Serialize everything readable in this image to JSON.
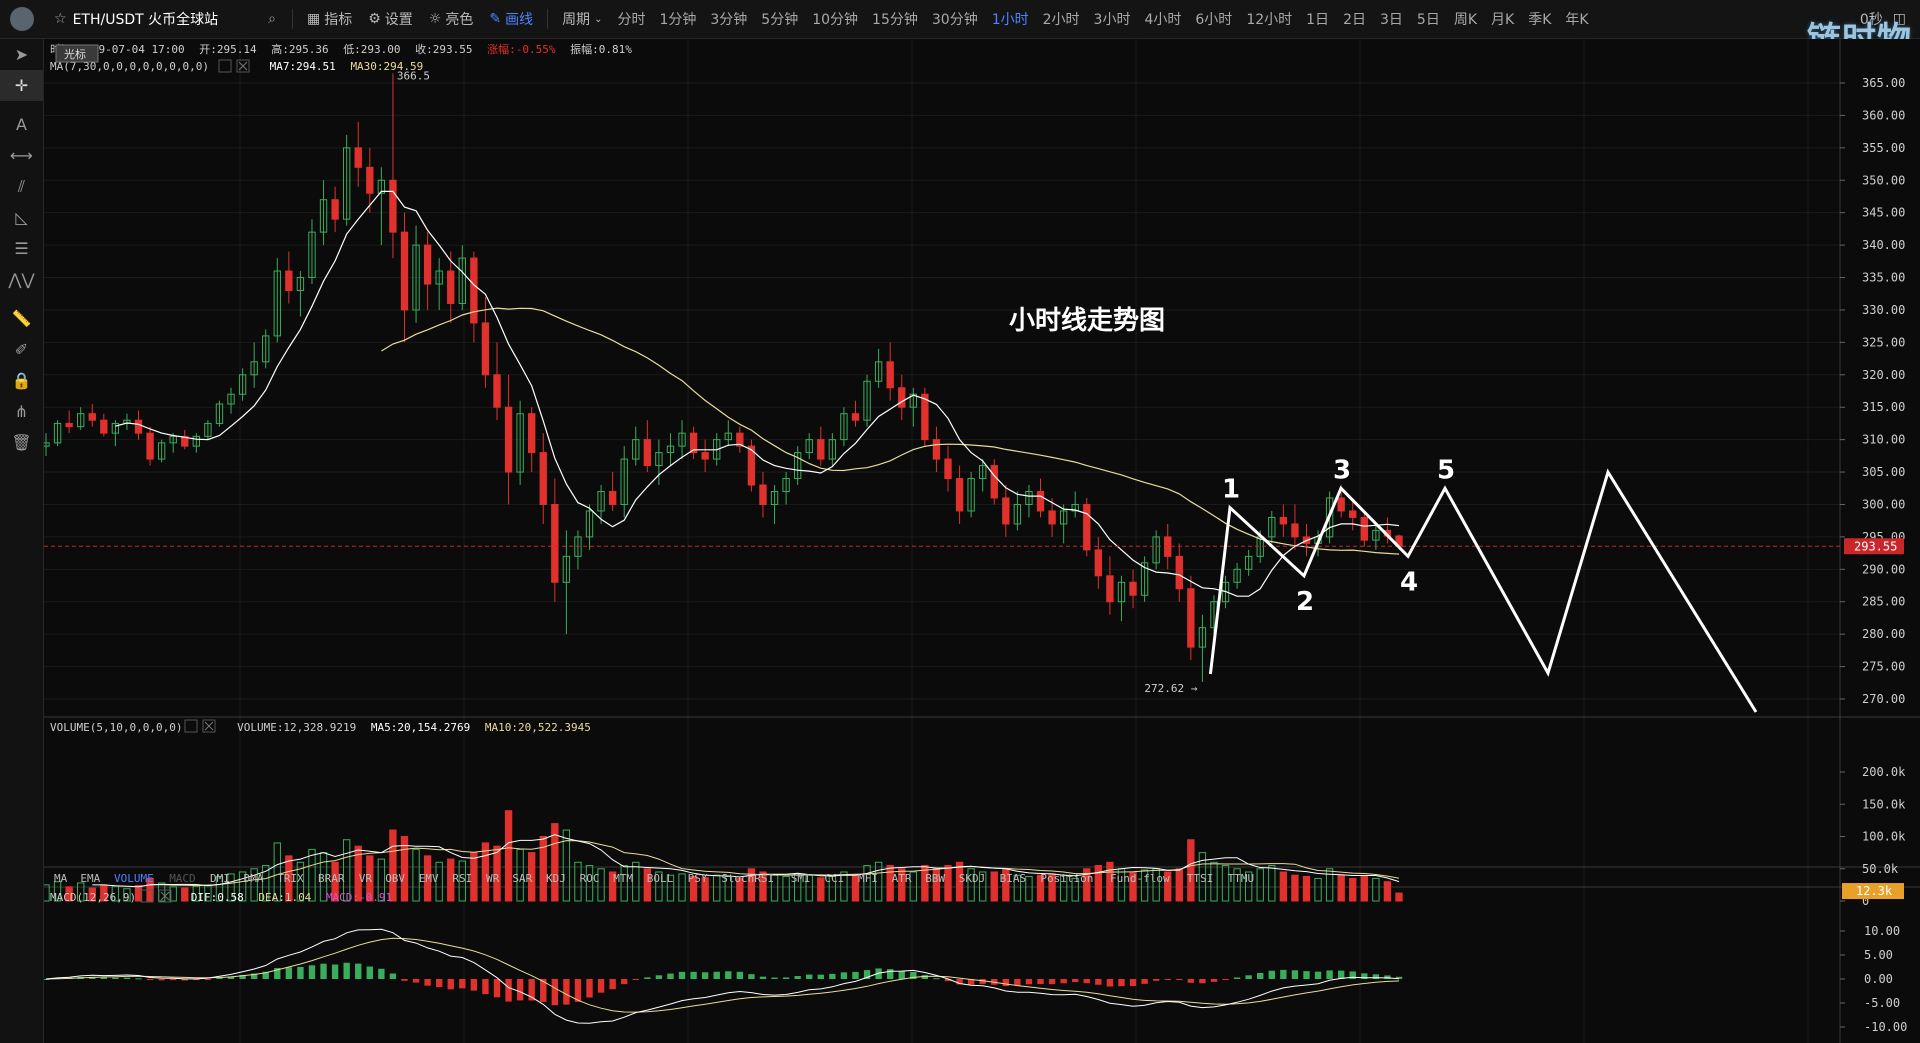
{
  "toolbar": {
    "pair": "ETH/USDT 火币全球站",
    "indicators_label": "指标",
    "settings_label": "设置",
    "theme_label": "亮色",
    "draw_label": "画线",
    "period_label": "周期",
    "periods": [
      "分时",
      "1分钟",
      "3分钟",
      "5分钟",
      "10分钟",
      "15分钟",
      "30分钟",
      "1小时",
      "2小时",
      "3小时",
      "4小时",
      "6小时",
      "12小时",
      "1日",
      "2日",
      "3日",
      "5日",
      "周K",
      "月K",
      "季K",
      "年K"
    ],
    "active_period": "1小时",
    "countdown": "0秒"
  },
  "brand": "链时物",
  "info_line": {
    "time": "时间:2019-07-04 17:00",
    "open": "开:295.14",
    "high": "高:295.36",
    "low": "低:293.00",
    "close": "收:293.55",
    "change": "涨幅:-0.55%",
    "amplitude": "振幅:0.81%"
  },
  "ma_line": {
    "label": "MA(7,30,0,0,0,0,0,0,0,0)",
    "ma7": "MA7:294.51",
    "ma30": "MA30:294.59"
  },
  "cursor_tag": "光标",
  "volume_line": {
    "label": "VOLUME(5,10,0,0,0,0)",
    "volume": "VOLUME:12,328.9219",
    "ma5": "MA5:20,154.2769",
    "ma10": "MA10:20,522.3945"
  },
  "indicator_tabs": [
    "MA",
    "EMA",
    "VOLUME",
    "MACD",
    "DMI",
    "DMA",
    "TRIX",
    "BRAR",
    "VR",
    "OBV",
    "EMV",
    "RSI",
    "WR",
    "SAR",
    "KDJ",
    "ROC",
    "MTM",
    "BOLL",
    "PSY",
    "StochRSI",
    "SMI",
    "CCI",
    "MFI",
    "ATR",
    "BBW",
    "SKDJ",
    "BIAS",
    "Position",
    "Fund-flow",
    "TTSI",
    "TTMU"
  ],
  "active_indicator_tab": "VOLUME",
  "macd_line": {
    "label": "MACD(12,26,9)",
    "dif": "DIF:0.58",
    "dea": "DEA:1.04",
    "macd": "MACD:-0.91"
  },
  "annotation_title": "小时线走势图",
  "wave_labels": [
    "1",
    "2",
    "3",
    "4",
    "5"
  ],
  "colors": {
    "up": "#3aad5c",
    "down": "#e0312d",
    "ma7": "#ffffff",
    "ma30": "#e8dc9a",
    "accent": "#4d82ff",
    "last_price_bg": "#c9262a",
    "volume_tag_bg": "#e8a02a"
  },
  "icons": [
    "cursor-icon",
    "crosshair-icon",
    "text-icon",
    "line-icon",
    "channel-icon",
    "triangle-icon",
    "fibonacci-icon",
    "pattern-icon",
    "ruler-icon",
    "brush-icon",
    "lock-icon",
    "magnet-icon",
    "trash-icon"
  ],
  "chart_data": {
    "type": "candlestick",
    "symbol": "ETH/USDT",
    "interval": "1小时",
    "price_axis": {
      "ticks": [
        270,
        275,
        280,
        285,
        290,
        295,
        300,
        305,
        310,
        315,
        320,
        325,
        330,
        335,
        340,
        345,
        350,
        355,
        360,
        365
      ],
      "range": [
        268,
        368
      ]
    },
    "last_price": 293.55,
    "last_price_label": "293.55",
    "high_marker": {
      "value": 366.5,
      "label": "366.5"
    },
    "low_marker": {
      "value": 272.62,
      "label": "272.62 →"
    },
    "volume_axis": {
      "ticks": [
        0,
        50000,
        100000,
        150000,
        200000
      ],
      "tick_labels": [
        "0",
        "50.0k",
        "100.0k",
        "150.0k",
        "200.0k"
      ],
      "current_label": "12.3k"
    },
    "macd_axis": {
      "ticks": [
        -10,
        -5,
        0,
        5,
        10
      ],
      "tick_labels": [
        "-10.00",
        "-5.00",
        "0.00",
        "5.00",
        "10.00"
      ]
    },
    "candles_ohlcv": [
      [
        309,
        311,
        307.5,
        309.5,
        25000
      ],
      [
        309.5,
        313,
        309,
        312.5,
        30000
      ],
      [
        312.5,
        314.5,
        311,
        312,
        22000
      ],
      [
        312,
        315,
        311.5,
        314,
        28000
      ],
      [
        314,
        315.5,
        312,
        313,
        20000
      ],
      [
        313,
        314,
        310.5,
        311,
        25000
      ],
      [
        311,
        313,
        309,
        312.5,
        23000
      ],
      [
        312.5,
        314,
        311.5,
        313,
        19000
      ],
      [
        313,
        314.5,
        310,
        311,
        24000
      ],
      [
        311,
        312,
        306,
        307,
        35000
      ],
      [
        307,
        310,
        306.5,
        309.5,
        28000
      ],
      [
        309.5,
        311,
        308,
        310.5,
        22000
      ],
      [
        310.5,
        311.5,
        308.5,
        309,
        20000
      ],
      [
        309,
        311,
        308,
        310.5,
        23000
      ],
      [
        310.5,
        313,
        310,
        312.5,
        25000
      ],
      [
        312.5,
        316,
        312,
        315.5,
        38000
      ],
      [
        315.5,
        318,
        314,
        317,
        42000
      ],
      [
        317,
        321,
        316,
        320,
        45000
      ],
      [
        320,
        325,
        318,
        322,
        50000
      ],
      [
        322,
        327,
        321,
        326,
        55000
      ],
      [
        326,
        338,
        325,
        336,
        90000
      ],
      [
        336,
        339,
        331,
        333,
        70000
      ],
      [
        333,
        336,
        329,
        335,
        60000
      ],
      [
        335,
        344,
        334,
        342,
        80000
      ],
      [
        342,
        350,
        340,
        347,
        75000
      ],
      [
        347,
        349,
        342,
        344,
        60000
      ],
      [
        344,
        357,
        343,
        355,
        95000
      ],
      [
        355,
        359,
        349,
        352,
        85000
      ],
      [
        352,
        355,
        345,
        348,
        70000
      ],
      [
        348,
        352,
        340,
        350,
        65000
      ],
      [
        350,
        366.5,
        338,
        342,
        110000
      ],
      [
        342,
        345,
        325,
        330,
        100000
      ],
      [
        330,
        343,
        328,
        340,
        80000
      ],
      [
        340,
        342,
        330,
        334,
        70000
      ],
      [
        334,
        338,
        330,
        336,
        60000
      ],
      [
        336,
        339,
        328,
        331,
        65000
      ],
      [
        331,
        340,
        330,
        338,
        62000
      ],
      [
        338,
        339,
        325,
        328,
        75000
      ],
      [
        328,
        332,
        318,
        320,
        90000
      ],
      [
        320,
        325,
        313,
        315,
        85000
      ],
      [
        315,
        320,
        300,
        305,
        140000
      ],
      [
        305,
        316,
        303,
        314,
        80000
      ],
      [
        314,
        315,
        305,
        308,
        75000
      ],
      [
        308,
        311,
        297,
        300,
        100000
      ],
      [
        300,
        304,
        285,
        288,
        120000
      ],
      [
        288,
        296,
        280,
        292,
        110000
      ],
      [
        292,
        296,
        290,
        295,
        60000
      ],
      [
        295,
        300,
        293,
        299,
        55000
      ],
      [
        299,
        303,
        297,
        302,
        50000
      ],
      [
        302,
        305,
        299,
        300,
        45000
      ],
      [
        300,
        309,
        298,
        307,
        55000
      ],
      [
        307,
        312,
        306,
        310,
        60000
      ],
      [
        310,
        313,
        305,
        306,
        50000
      ],
      [
        306,
        310,
        303,
        308,
        45000
      ],
      [
        308,
        311,
        306,
        309,
        40000
      ],
      [
        309,
        313,
        307,
        311,
        42000
      ],
      [
        311,
        312,
        307,
        308,
        38000
      ],
      [
        308,
        310,
        305,
        307,
        36000
      ],
      [
        307,
        311,
        306,
        310,
        40000
      ],
      [
        310,
        313,
        309,
        311,
        38000
      ],
      [
        311,
        312,
        308,
        309,
        35000
      ],
      [
        309,
        310,
        302,
        303,
        50000
      ],
      [
        303,
        305,
        298,
        300,
        45000
      ],
      [
        300,
        303,
        297,
        302,
        40000
      ],
      [
        302,
        305,
        300,
        304,
        38000
      ],
      [
        304,
        309,
        303,
        308,
        42000
      ],
      [
        308,
        311,
        307,
        310,
        40000
      ],
      [
        310,
        312,
        306,
        307,
        36000
      ],
      [
        307,
        311,
        306,
        310,
        38000
      ],
      [
        310,
        315,
        309,
        314,
        45000
      ],
      [
        314,
        316,
        312,
        313,
        40000
      ],
      [
        313,
        320,
        312,
        319,
        55000
      ],
      [
        319,
        324,
        318,
        322,
        60000
      ],
      [
        322,
        325,
        316,
        318,
        55000
      ],
      [
        318,
        320,
        313,
        315,
        50000
      ],
      [
        315,
        318,
        312,
        317,
        45000
      ],
      [
        317,
        318,
        309,
        310,
        55000
      ],
      [
        310,
        312,
        305,
        307,
        50000
      ],
      [
        307,
        309,
        302,
        304,
        55000
      ],
      [
        304,
        306,
        297,
        299,
        60000
      ],
      [
        299,
        305,
        298,
        304,
        50000
      ],
      [
        304,
        307,
        302,
        306,
        45000
      ],
      [
        306,
        307,
        300,
        301,
        45000
      ],
      [
        301,
        303,
        295,
        297,
        50000
      ],
      [
        297,
        302,
        296,
        300,
        40000
      ],
      [
        300,
        303,
        298,
        302,
        38000
      ],
      [
        302,
        304,
        298,
        299,
        40000
      ],
      [
        299,
        301,
        295,
        297,
        42000
      ],
      [
        297,
        300,
        294,
        299,
        40000
      ],
      [
        299,
        302,
        298,
        300,
        35000
      ],
      [
        300,
        301,
        292,
        293,
        50000
      ],
      [
        293,
        295,
        287,
        289,
        55000
      ],
      [
        289,
        292,
        283,
        285,
        60000
      ],
      [
        285,
        289,
        282,
        288,
        50000
      ],
      [
        288,
        290,
        284,
        286,
        45000
      ],
      [
        286,
        292,
        285,
        291,
        48000
      ],
      [
        291,
        296,
        290,
        295,
        50000
      ],
      [
        295,
        297,
        290,
        292,
        45000
      ],
      [
        292,
        294,
        285,
        287,
        50000
      ],
      [
        287,
        289,
        276,
        278,
        95000
      ],
      [
        278,
        283,
        272.62,
        281,
        75000
      ],
      [
        281,
        286,
        280,
        285,
        60000
      ],
      [
        285,
        289,
        284,
        288,
        55000
      ],
      [
        288,
        291,
        287,
        290,
        50000
      ],
      [
        290,
        293,
        289,
        292,
        45000
      ],
      [
        292,
        296,
        291,
        295,
        50000
      ],
      [
        295,
        299,
        294,
        298,
        55000
      ],
      [
        298,
        300,
        295,
        297,
        45000
      ],
      [
        297,
        300,
        293,
        295,
        40000
      ],
      [
        295,
        297,
        292,
        294,
        38000
      ],
      [
        294,
        296,
        292,
        295,
        35000
      ],
      [
        295,
        302,
        294,
        301,
        50000
      ],
      [
        301,
        303,
        298,
        299,
        40000
      ],
      [
        299,
        301,
        296,
        298,
        35000
      ],
      [
        298,
        299,
        293.5,
        294.5,
        38000
      ],
      [
        294.5,
        297,
        293,
        296,
        35000
      ],
      [
        296,
        298,
        294,
        295.14,
        30000
      ],
      [
        295.14,
        295.36,
        293,
        293.55,
        12329
      ]
    ],
    "ma_series": [
      {
        "name": "MA7",
        "period": 7
      },
      {
        "name": "MA30",
        "period": 30
      }
    ],
    "volume_ma_series": [
      {
        "name": "MA5",
        "period": 5
      },
      {
        "name": "MA10",
        "period": 10
      }
    ],
    "macd_params": [
      12,
      26,
      9
    ],
    "macd_readout": {
      "dif": 0.58,
      "dea": 1.04,
      "macd": -0.91
    },
    "projection_zigzag": [
      {
        "label": "1",
        "price": 299.5
      },
      {
        "label": "2",
        "price": 289
      },
      {
        "label": "3",
        "price": 302.5
      },
      {
        "label": "4",
        "price": 292
      },
      {
        "label": "5",
        "price": 302.5
      },
      {
        "label": "",
        "price": 274
      },
      {
        "label": "",
        "price": 305
      },
      {
        "label": "",
        "price": 268
      }
    ]
  }
}
